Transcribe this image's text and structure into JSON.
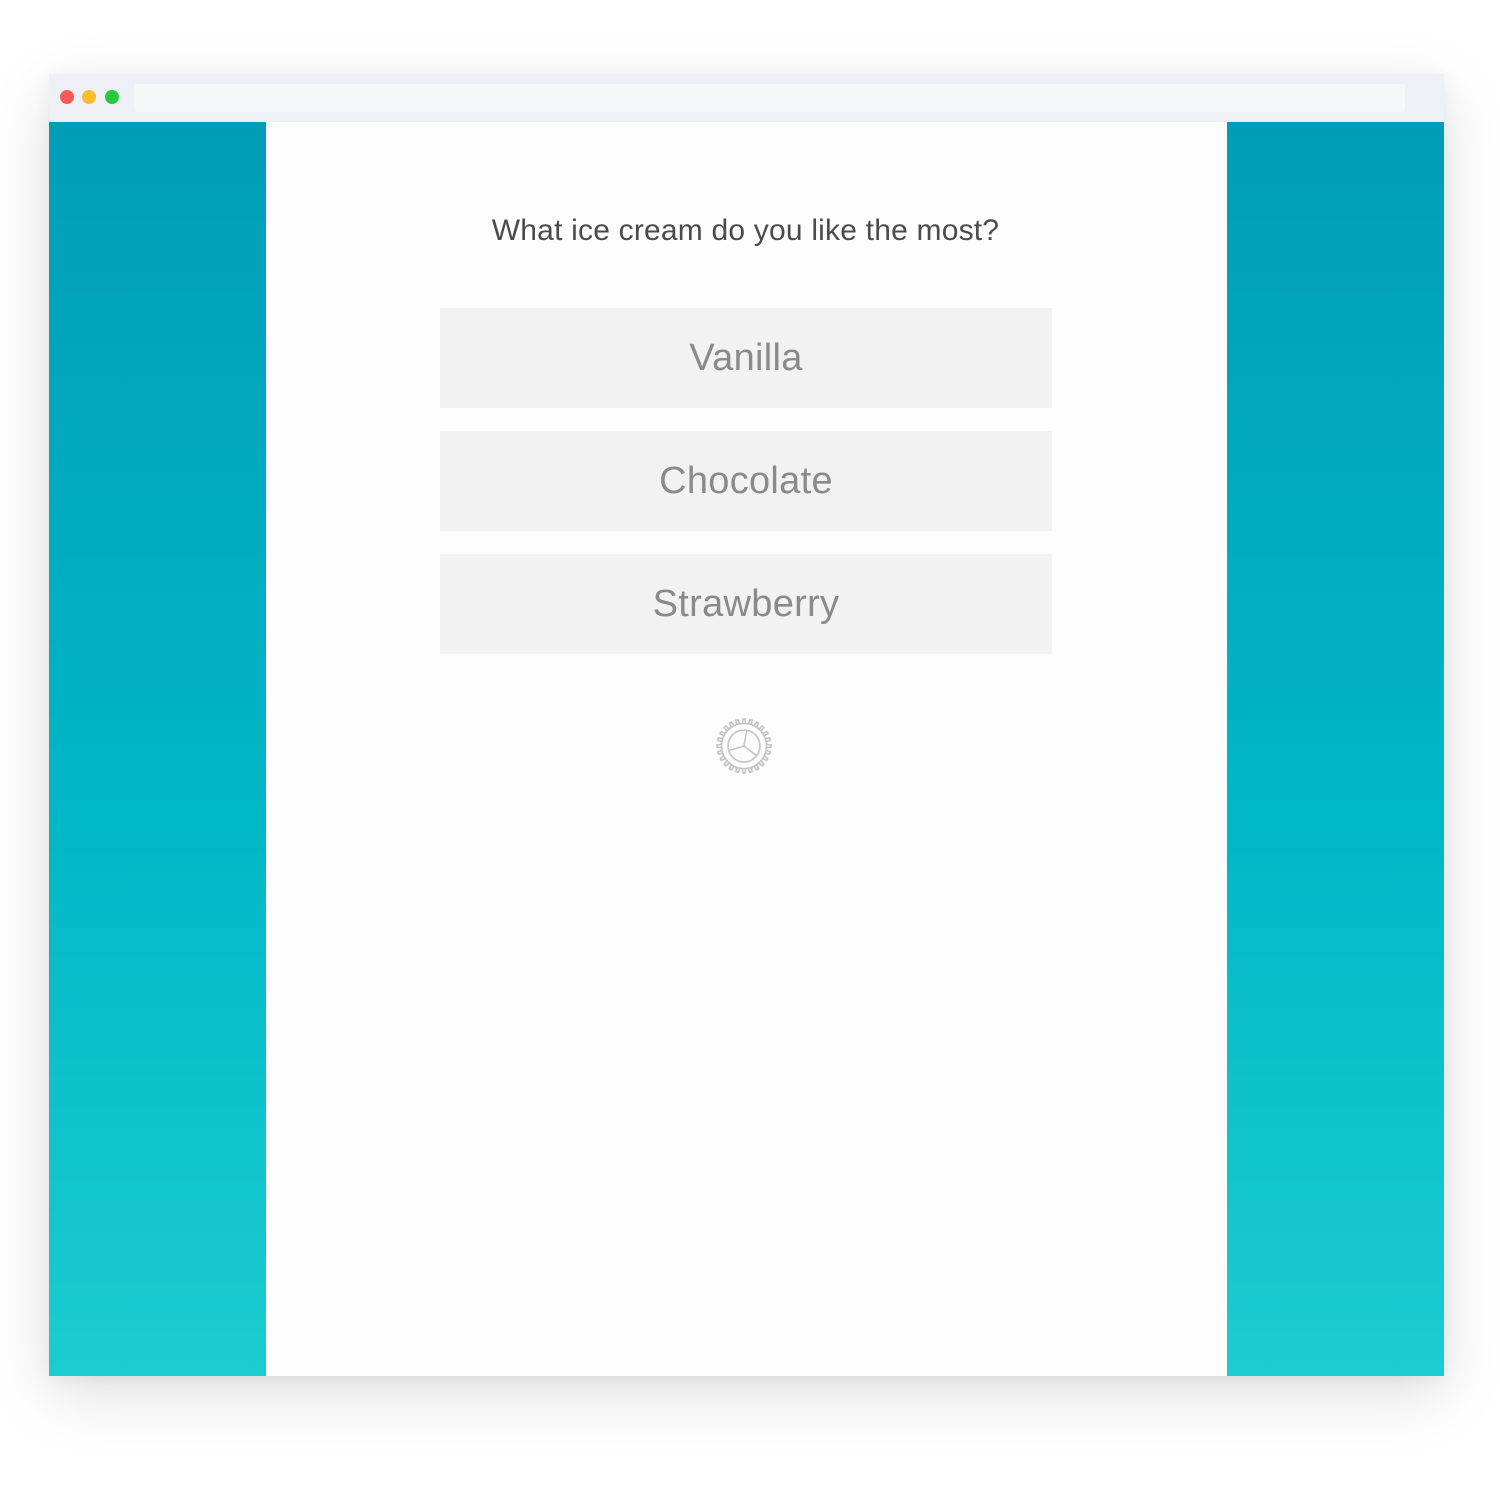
{
  "browser": {
    "address": ""
  },
  "survey": {
    "question": "What ice cream do you like the most?",
    "options": [
      {
        "label": "Vanilla"
      },
      {
        "label": "Chocolate"
      },
      {
        "label": "Strawberry"
      }
    ]
  },
  "footer": {
    "logo_icon": "gear-icon"
  },
  "colors": {
    "side_gradient_top": "#009db7",
    "side_gradient_bottom": "#1bcdd0",
    "option_bg": "#f2f2f2",
    "option_text": "#8a8a8a",
    "question_text": "#4b4b4b"
  }
}
